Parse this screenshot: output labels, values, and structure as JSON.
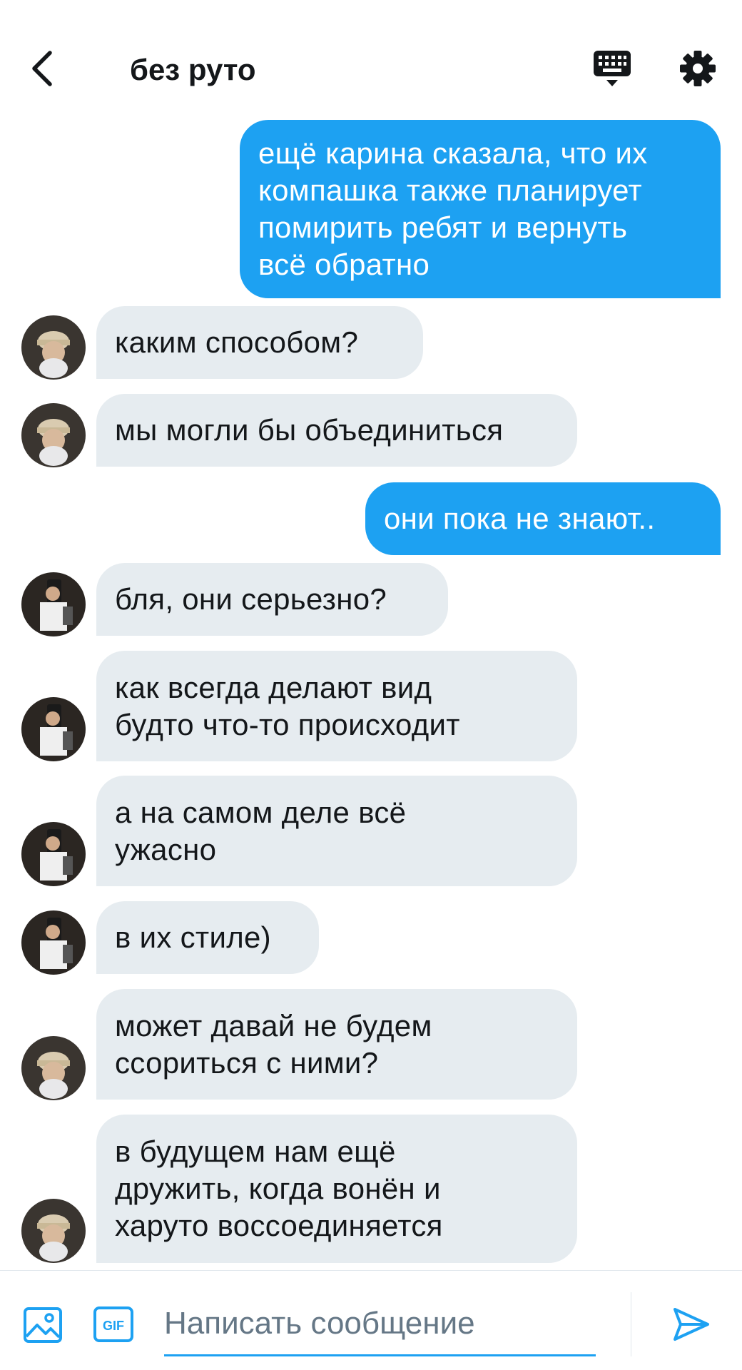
{
  "header": {
    "title": "без руто"
  },
  "icons": {
    "back": "chevron-left-icon",
    "keyboard": "keyboard-icon",
    "settings": "gear-icon",
    "image": "image-icon",
    "gif": "gif-icon",
    "send": "send-icon"
  },
  "colors": {
    "accent": "#1da1f2",
    "incoming_bubble": "#e6ecf0",
    "text": "#14171a",
    "placeholder": "#657786"
  },
  "messages": [
    {
      "direction": "out",
      "text": "ещё карина сказала, что их\nкомпашка также планирует\nпомирить ребят и вернуть\nвсё обратно"
    },
    {
      "direction": "in",
      "text": "каким способом?"
    },
    {
      "direction": "in",
      "text": "мы могли бы объединиться"
    },
    {
      "direction": "out",
      "text": "они пока не знают.."
    },
    {
      "direction": "in",
      "text": "бля, они серьезно?"
    },
    {
      "direction": "in",
      "text": "как всегда делают вид\nбудто что-то происходит"
    },
    {
      "direction": "in",
      "text": "а на самом деле всё\nужасно"
    },
    {
      "direction": "in",
      "text": "в их стиле)"
    },
    {
      "direction": "in",
      "text": "может давай не будем\nссориться с ними?"
    },
    {
      "direction": "in",
      "text": "в будущем нам ещё\nдружить, когда вонён и\nхаруто воссоединяется"
    }
  ],
  "composer": {
    "placeholder": "Написать сообщение",
    "value": ""
  }
}
